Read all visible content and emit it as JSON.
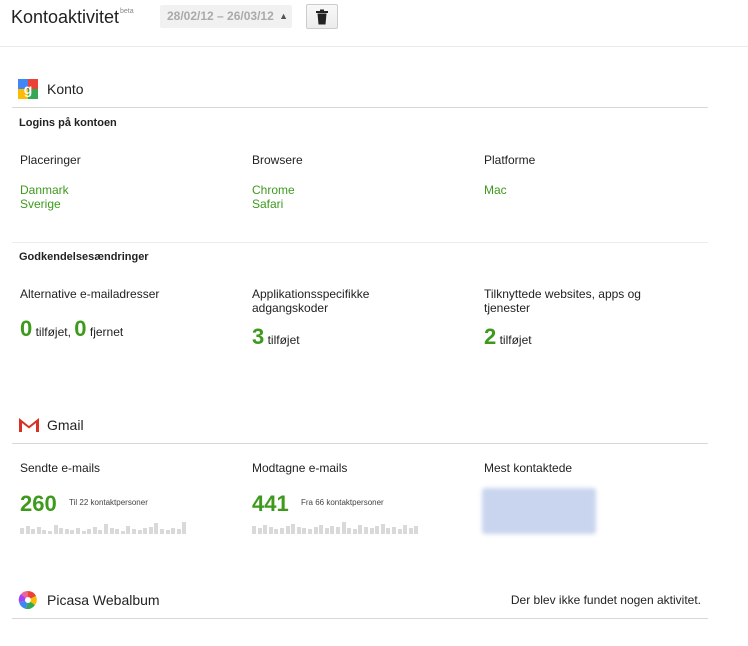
{
  "header": {
    "title": "Kontoaktivitet",
    "beta": "beta",
    "date_range": "28/02/12 – 26/03/12"
  },
  "konto": {
    "title": "Konto",
    "logins": {
      "heading": "Logins på kontoen",
      "columns": [
        {
          "label": "Placeringer",
          "items": [
            "Danmark",
            "Sverige"
          ]
        },
        {
          "label": "Browsere",
          "items": [
            "Chrome",
            "Safari"
          ]
        },
        {
          "label": "Platforme",
          "items": [
            "Mac"
          ]
        }
      ]
    },
    "auth": {
      "heading": "Godkendelsesændringer",
      "alt_email": {
        "label": "Alternative e-mailadresser",
        "added": "0",
        "added_label": "tilføjet,",
        "removed": "0",
        "removed_label": "fjernet"
      },
      "app_pw": {
        "label1": "Applikationsspecifikke",
        "label2": "adgangskoder",
        "count": "3",
        "count_label": "tilføjet"
      },
      "connected": {
        "label1": "Tilknyttede websites, apps og",
        "label2": "tjenester",
        "count": "2",
        "count_label": "tilføjet"
      }
    }
  },
  "gmail": {
    "title": "Gmail",
    "sent": {
      "label": "Sendte e-mails",
      "count": "260",
      "note": "Til 22 kontaktpersoner"
    },
    "received": {
      "label": "Modtagne e-mails",
      "count": "441",
      "note": "Fra 66 kontaktpersoner"
    },
    "most": {
      "label": "Mest kontaktede"
    }
  },
  "picasa": {
    "title": "Picasa Webalbum",
    "empty": "Der blev ikke fundet nogen aktivitet."
  },
  "colors": {
    "accent_green": "#3d9a1c"
  }
}
